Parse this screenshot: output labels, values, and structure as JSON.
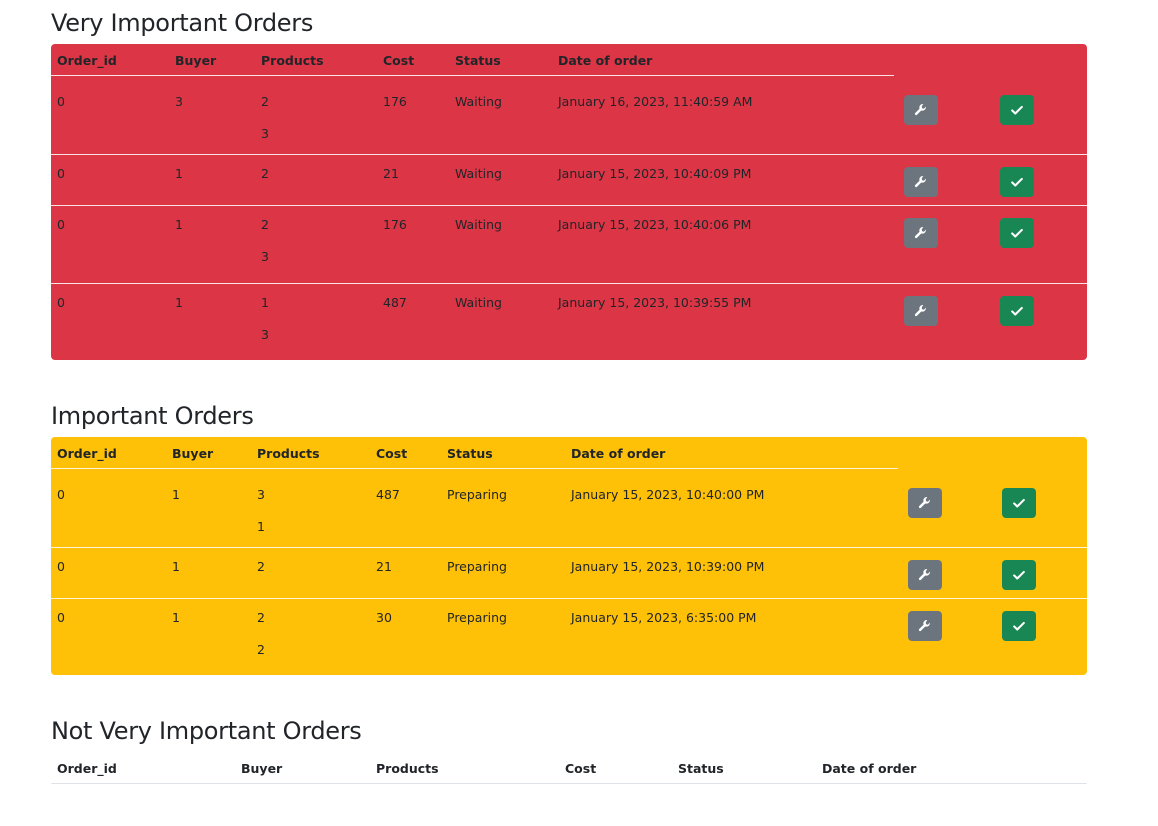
{
  "columns": [
    "Order_id",
    "Buyer",
    "Products",
    "Cost",
    "Status",
    "Date of order"
  ],
  "colors": {
    "very_important": "#dc3545",
    "important": "#ffc107",
    "edit_button": "#6c757d",
    "complete_button": "#198754"
  },
  "icons": {
    "edit": "wrench-icon",
    "complete": "check-icon"
  },
  "very_important": {
    "title": "Very Important Orders",
    "rows": [
      {
        "order_id": "0",
        "buyer": "3",
        "products": [
          "2",
          "3"
        ],
        "cost": "176",
        "status": "Waiting",
        "date": "January 16, 2023, 11:40:59 AM"
      },
      {
        "order_id": "0",
        "buyer": "1",
        "products": [
          "2"
        ],
        "cost": "21",
        "status": "Waiting",
        "date": "January 15, 2023, 10:40:09 PM"
      },
      {
        "order_id": "0",
        "buyer": "1",
        "products": [
          "2",
          "3"
        ],
        "cost": "176",
        "status": "Waiting",
        "date": "January 15, 2023, 10:40:06 PM"
      },
      {
        "order_id": "0",
        "buyer": "1",
        "products": [
          "1",
          "3"
        ],
        "cost": "487",
        "status": "Waiting",
        "date": "January 15, 2023, 10:39:55 PM"
      }
    ]
  },
  "important": {
    "title": "Important Orders",
    "rows": [
      {
        "order_id": "0",
        "buyer": "1",
        "products": [
          "3",
          "1"
        ],
        "cost": "487",
        "status": "Preparing",
        "date": "January 15, 2023, 10:40:00 PM"
      },
      {
        "order_id": "0",
        "buyer": "1",
        "products": [
          "2"
        ],
        "cost": "21",
        "status": "Preparing",
        "date": "January 15, 2023, 10:39:00 PM"
      },
      {
        "order_id": "0",
        "buyer": "1",
        "products": [
          "2",
          "2"
        ],
        "cost": "30",
        "status": "Preparing",
        "date": "January 15, 2023, 6:35:00 PM"
      }
    ]
  },
  "not_very_important": {
    "title": "Not Very Important Orders",
    "rows": []
  }
}
